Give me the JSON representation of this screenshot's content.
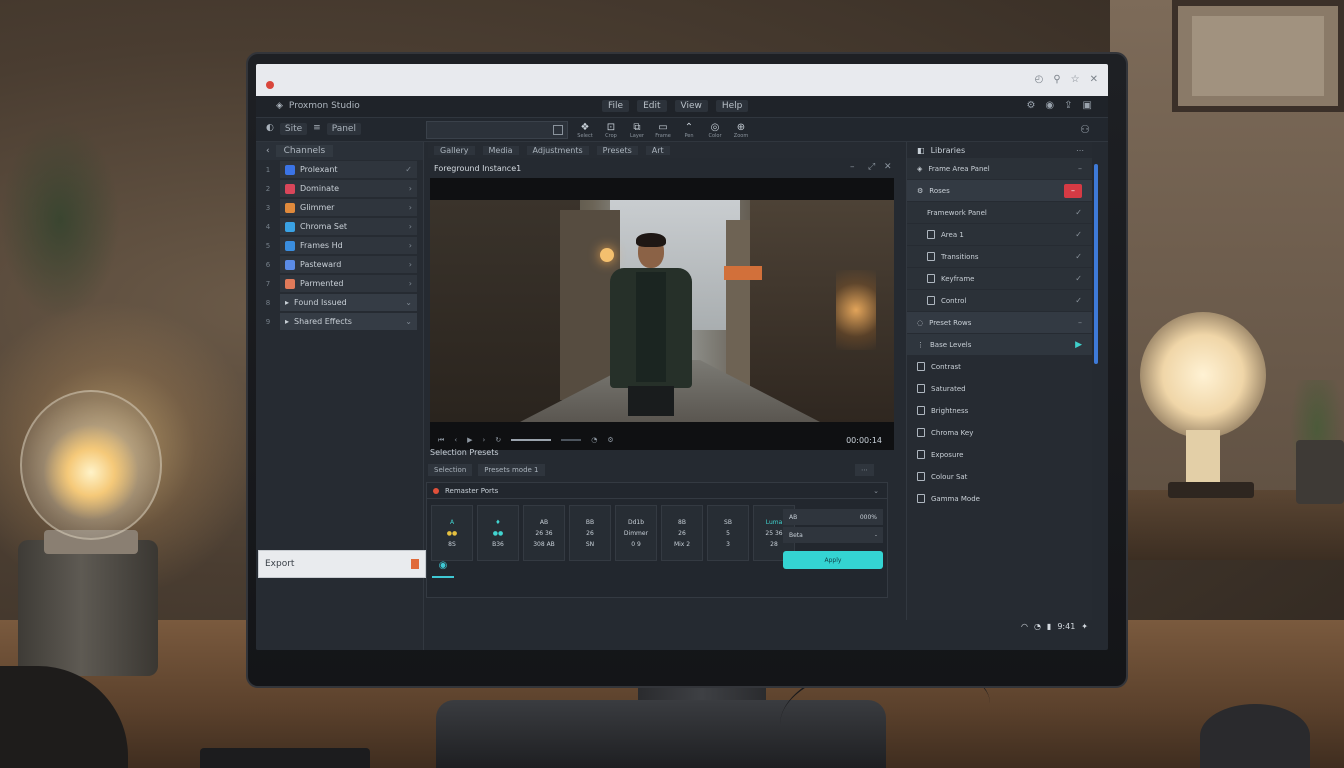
{
  "browser": {
    "tab_text": ""
  },
  "app": {
    "title": "Proxmon Studio"
  },
  "menu": [
    "File",
    "Edit",
    "View",
    "Help"
  ],
  "toolbar": {
    "left_items": [
      "Site",
      "Panel"
    ],
    "field_value": "",
    "tools": [
      {
        "icon": "❖",
        "label": "Select"
      },
      {
        "icon": "⊡",
        "label": "Crop"
      },
      {
        "icon": "⧉",
        "label": "Layer"
      },
      {
        "icon": "▭",
        "label": "Frame"
      },
      {
        "icon": "⌃",
        "label": "Pen"
      },
      {
        "icon": "◎",
        "label": "Color"
      },
      {
        "icon": "⊕",
        "label": "Zoom"
      }
    ]
  },
  "left_panel": {
    "header": "Channels",
    "items": [
      {
        "num": "1",
        "label": "Prolexant",
        "color": "#3b74e6",
        "arrow": "✓"
      },
      {
        "num": "2",
        "label": "Dominate",
        "color": "#d9465a",
        "arrow": "›"
      },
      {
        "num": "3",
        "label": "Glimmer",
        "color": "#e08a3c",
        "arrow": "›"
      },
      {
        "num": "4",
        "label": "Chroma Set",
        "color": "#3aa2e4",
        "arrow": "›"
      },
      {
        "num": "5",
        "label": "Frames Hd",
        "color": "#3a8ee0",
        "arrow": "›"
      },
      {
        "num": "6",
        "label": "Pasteward",
        "color": "#5b8be6",
        "arrow": "›"
      },
      {
        "num": "7",
        "label": "Parmented",
        "color": "#e07a5a",
        "arrow": "›"
      }
    ],
    "groups": [
      {
        "num": "8",
        "label": "Found Issued"
      },
      {
        "num": "9",
        "label": "Shared Effects"
      }
    ]
  },
  "center": {
    "tabs": [
      "Gallery",
      "Media",
      "Adjustments",
      "Presets",
      "Art"
    ],
    "viewer_title": "Foreground Instance1",
    "timecode": "00:00:14",
    "section_title": "Selection Presets",
    "section_tabs": [
      "Selection",
      "Presets mode 1"
    ],
    "effects_title": "Remaster Ports",
    "cells": [
      {
        "top": "A",
        "mid": "●●",
        "bot": "8S"
      },
      {
        "top": "♦",
        "mid": "●●",
        "bot": "B36"
      },
      {
        "top": "AB",
        "mid": "26 36",
        "bot": "308 AB"
      },
      {
        "top": "BB",
        "mid": "26",
        "bot": "SN"
      },
      {
        "top": "Dd1b",
        "mid": "Dimmer",
        "bot": "0 9"
      },
      {
        "top": "8B",
        "mid": "26",
        "bot": "Mix 2"
      },
      {
        "top": "SB",
        "mid": "5",
        "bot": "3"
      },
      {
        "top": "Luma",
        "mid": "25 36",
        "bot": "28"
      }
    ],
    "props": [
      {
        "label": "AB",
        "value": "000%"
      },
      {
        "label": "Beta",
        "value": "-"
      }
    ],
    "apply_label": "Apply"
  },
  "right_panel": {
    "header": "Libraries",
    "rows": [
      {
        "label": "Frame Area Panel",
        "type": "chk"
      },
      {
        "label": "Roses",
        "type": "red"
      },
      {
        "label": "Framework Panel",
        "type": "chk",
        "indent": true
      },
      {
        "label": "Area 1",
        "type": "chk",
        "indent": true
      },
      {
        "label": "Transitions",
        "type": "chk",
        "indent": true
      },
      {
        "label": "Keyframe",
        "type": "chk",
        "indent": true
      },
      {
        "label": "Control",
        "type": "chk",
        "indent": true
      },
      {
        "label": "Preset Rows",
        "type": "section"
      },
      {
        "label": "Base Levels",
        "type": "play"
      },
      {
        "label": "Contrast",
        "type": "file"
      },
      {
        "label": "Saturated",
        "type": "file"
      },
      {
        "label": "Brightness",
        "type": "file"
      },
      {
        "label": "Chroma Key",
        "type": "file"
      },
      {
        "label": "Exposure",
        "type": "file"
      },
      {
        "label": "Colour Sat",
        "type": "file"
      },
      {
        "label": "Gamma Mode",
        "type": "file"
      }
    ]
  },
  "taskbar": {
    "window_label": "Export",
    "clock": "9:41"
  }
}
